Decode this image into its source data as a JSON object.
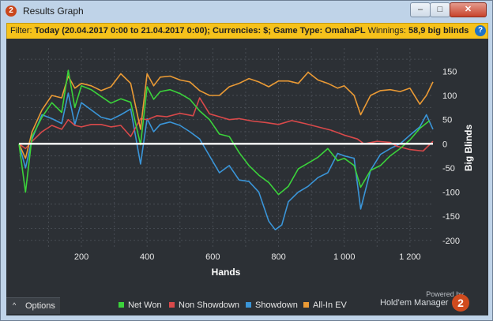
{
  "window": {
    "title": "Results Graph",
    "app_icon": "2",
    "min_glyph": "–",
    "max_glyph": "□",
    "close_glyph": "✕"
  },
  "filter": {
    "prefix": "Filter:",
    "text": "Today (20.04.2017 0:00 to 21.04.2017 0:00); Currencies: $; Game Type: OmahaPL",
    "winnings_label": "Winnings:",
    "winnings_value": "58,9 big blinds",
    "help_glyph": "?"
  },
  "options": {
    "label": "Options",
    "caret": "^"
  },
  "branding": {
    "powered": "Powered by",
    "name": "Hold'em Manager",
    "logo": "2"
  },
  "colors": {
    "net_won": "#3bd23b",
    "non_showdown": "#d9494a",
    "showdown": "#3a95d8",
    "all_in_ev": "#ea9a35",
    "zero_line": "#ffffff",
    "filter_bar": "#f6c21b"
  },
  "chart_data": {
    "type": "line",
    "xlabel": "Hands",
    "ylabel": "Big Blinds",
    "xlim": [
      10,
      1270
    ],
    "ylim": [
      -215,
      198
    ],
    "xticks": [
      200,
      400,
      600,
      800,
      1000,
      1200
    ],
    "xtick_labels": [
      "200",
      "400",
      "600",
      "800",
      "1 000",
      "1 200"
    ],
    "yticks": [
      150,
      100,
      50,
      0,
      -50,
      -100,
      -150,
      -200
    ],
    "ytick_labels": [
      "150",
      "100",
      "50",
      "0",
      "-50",
      "-100",
      "-150",
      "-200"
    ],
    "grid": true,
    "legend": "bottom",
    "series": [
      {
        "name": "Net Won",
        "color_key": "net_won",
        "x": [
          10,
          30,
          50,
          80,
          110,
          140,
          160,
          180,
          200,
          230,
          260,
          290,
          320,
          350,
          380,
          400,
          420,
          440,
          470,
          500,
          530,
          560,
          590,
          620,
          650,
          680,
          710,
          740,
          770,
          800,
          830,
          860,
          890,
          920,
          950,
          980,
          1000,
          1030,
          1050,
          1080,
          1110,
          1140,
          1170,
          1200,
          1230,
          1260
        ],
        "y": [
          0,
          -100,
          15,
          55,
          85,
          65,
          152,
          75,
          120,
          112,
          98,
          84,
          93,
          86,
          -2,
          118,
          92,
          108,
          112,
          104,
          92,
          68,
          50,
          20,
          15,
          -18,
          -45,
          -65,
          -80,
          -105,
          -88,
          -52,
          -40,
          -28,
          -10,
          -35,
          -30,
          -45,
          -90,
          -55,
          -45,
          -25,
          -10,
          8,
          32,
          48
        ]
      },
      {
        "name": "Non Showdown",
        "color_key": "non_showdown",
        "x": [
          10,
          30,
          50,
          80,
          110,
          140,
          160,
          180,
          200,
          230,
          260,
          290,
          320,
          350,
          380,
          400,
          430,
          460,
          500,
          540,
          560,
          590,
          620,
          650,
          680,
          720,
          760,
          800,
          840,
          880,
          920,
          960,
          1000,
          1040,
          1060,
          1100,
          1140,
          1160,
          1200,
          1240,
          1270
        ],
        "y": [
          0,
          -10,
          5,
          25,
          38,
          30,
          50,
          38,
          35,
          40,
          40,
          35,
          38,
          15,
          52,
          50,
          58,
          56,
          63,
          58,
          95,
          62,
          56,
          50,
          52,
          47,
          44,
          40,
          48,
          42,
          35,
          28,
          18,
          10,
          0,
          5,
          3,
          -5,
          -12,
          -15,
          5
        ]
      },
      {
        "name": "Showdown",
        "color_key": "showdown",
        "x": [
          10,
          30,
          50,
          80,
          110,
          140,
          160,
          180,
          200,
          230,
          260,
          290,
          320,
          350,
          380,
          400,
          420,
          440,
          470,
          500,
          530,
          560,
          590,
          620,
          650,
          680,
          710,
          740,
          770,
          790,
          810,
          830,
          860,
          890,
          920,
          950,
          980,
          1000,
          1030,
          1050,
          1080,
          1110,
          1140,
          1170,
          1200,
          1230,
          1250,
          1270
        ],
        "y": [
          0,
          -50,
          10,
          60,
          52,
          42,
          105,
          40,
          85,
          70,
          55,
          50,
          60,
          72,
          -42,
          52,
          25,
          40,
          45,
          38,
          25,
          10,
          -25,
          -60,
          -45,
          -75,
          -78,
          -100,
          -160,
          -178,
          -168,
          -120,
          -100,
          -88,
          -70,
          -60,
          -20,
          -25,
          -30,
          -135,
          -55,
          -22,
          -10,
          0,
          18,
          35,
          60,
          30
        ]
      },
      {
        "name": "All-In EV",
        "color_key": "all_in_ev",
        "x": [
          10,
          30,
          50,
          80,
          110,
          140,
          160,
          180,
          200,
          230,
          260,
          290,
          320,
          350,
          380,
          400,
          420,
          440,
          470,
          500,
          530,
          560,
          590,
          620,
          650,
          680,
          710,
          740,
          770,
          800,
          830,
          860,
          890,
          920,
          950,
          980,
          1000,
          1030,
          1050,
          1080,
          1110,
          1140,
          1170,
          1200,
          1230,
          1250,
          1270
        ],
        "y": [
          0,
          -30,
          25,
          70,
          100,
          95,
          140,
          115,
          125,
          120,
          110,
          118,
          145,
          125,
          30,
          145,
          120,
          138,
          140,
          132,
          128,
          110,
          100,
          100,
          118,
          125,
          135,
          128,
          118,
          130,
          130,
          125,
          148,
          132,
          125,
          115,
          120,
          100,
          60,
          100,
          110,
          112,
          108,
          115,
          82,
          100,
          128
        ]
      }
    ]
  }
}
